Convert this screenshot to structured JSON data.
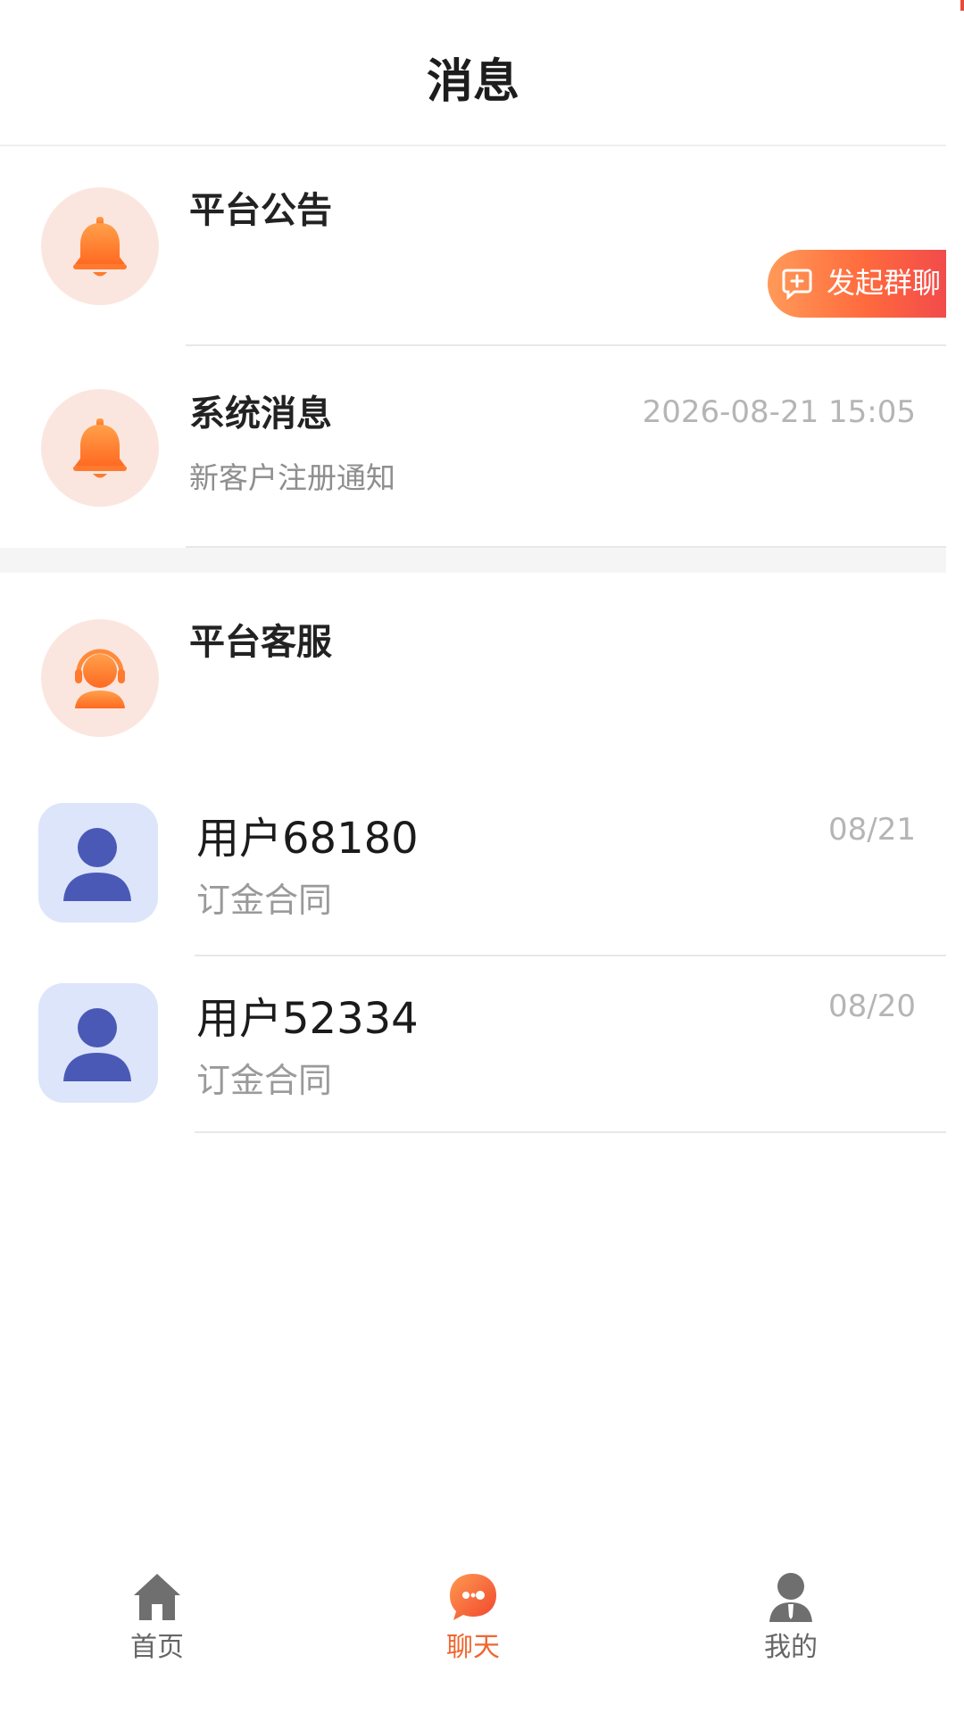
{
  "header": {
    "title": "消息"
  },
  "announcement": {
    "name": "平台公告"
  },
  "group_button": {
    "label": "发起群聊"
  },
  "system_message": {
    "name": "系统消息",
    "time": "2026-08-21 15:05",
    "preview": "新客户注册通知"
  },
  "customer_service": {
    "name": "平台客服"
  },
  "chats": [
    {
      "name": "用户68180",
      "date": "08/21",
      "preview": "订金合同"
    },
    {
      "name": "用户52334",
      "date": "08/20",
      "preview": "订金合同"
    }
  ],
  "tabbar": {
    "home": "首页",
    "chat": "聊天",
    "mine": "我的",
    "active": "chat"
  },
  "colors": {
    "accent": "#f0662f",
    "avatar_blue": "#4b59b6",
    "avatar_bg_blue": "#dde5fb",
    "avatar_bg_peach": "#fbe6df"
  }
}
